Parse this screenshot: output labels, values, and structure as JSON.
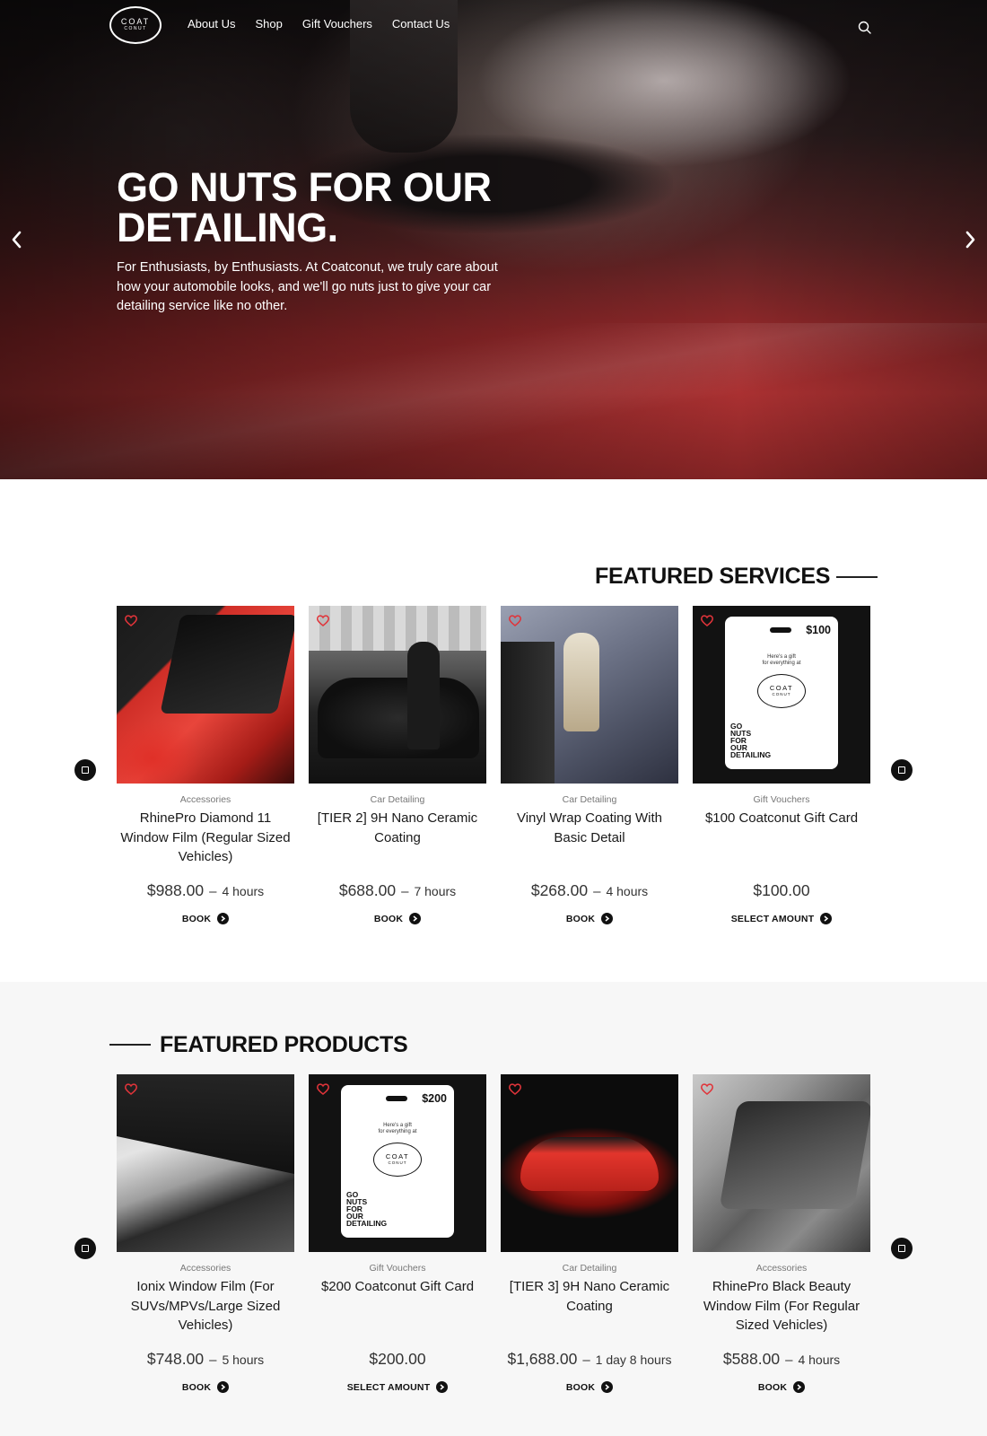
{
  "nav": {
    "logo_line1": "COAT",
    "logo_line2": "CONUT",
    "links": [
      "About Us",
      "Shop",
      "Gift Vouchers",
      "Contact Us"
    ]
  },
  "hero": {
    "title_line1": "GO NUTS FOR OUR",
    "title_line2": "DETAILING.",
    "subtitle": "For Enthusiasts, by Enthusiasts. At Coatconut, we truly care about how your automobile looks, and we'll go nuts just to give your car detailing service like no other."
  },
  "services": {
    "heading": "FEATURED SERVICES",
    "items": [
      {
        "category": "Accessories",
        "name": "RhinePro Diamond 11 Window Film (Regular Sized Vehicles)",
        "price": "$988.00",
        "duration": "4 hours",
        "cta": "BOOK"
      },
      {
        "category": "Car Detailing",
        "name": "[TIER 2] 9H Nano Ceramic Coating",
        "price": "$688.00",
        "duration": "7 hours",
        "cta": "BOOK"
      },
      {
        "category": "Car Detailing",
        "name": "Vinyl Wrap Coating With Basic Detail",
        "price": "$268.00",
        "duration": "4 hours",
        "cta": "BOOK"
      },
      {
        "category": "Gift Vouchers",
        "name": "$100 Coatconut Gift Card",
        "price": "$100.00",
        "duration": "",
        "cta": "SELECT AMOUNT"
      }
    ]
  },
  "products": {
    "heading": "FEATURED PRODUCTS",
    "items": [
      {
        "category": "Accessories",
        "name": "Ionix Window Film (For SUVs/MPVs/Large Sized Vehicles)",
        "price": "$748.00",
        "duration": "5 hours",
        "cta": "BOOK"
      },
      {
        "category": "Gift Vouchers",
        "name": "$200 Coatconut Gift Card",
        "price": "$200.00",
        "duration": "",
        "cta": "SELECT AMOUNT"
      },
      {
        "category": "Car Detailing",
        "name": "[TIER 3] 9H Nano Ceramic Coating",
        "price": "$1,688.00",
        "duration": "1 day 8 hours",
        "cta": "BOOK"
      },
      {
        "category": "Accessories",
        "name": "RhinePro Black Beauty Window Film (For Regular Sized Vehicles)",
        "price": "$588.00",
        "duration": "4 hours",
        "cta": "BOOK"
      }
    ]
  },
  "gift_cards": {
    "card100": {
      "amount": "$100",
      "note_line1": "Here's a gift",
      "note_line2": "for everything at",
      "mark1": "COAT",
      "mark2": "CONUT",
      "slogan": [
        "GO",
        "NUTS",
        "FOR",
        "OUR",
        "DETAILING"
      ]
    },
    "card200": {
      "amount": "$200",
      "note_line1": "Here's a gift",
      "note_line2": "for everything at",
      "mark1": "COAT",
      "mark2": "CONUT",
      "slogan": [
        "GO",
        "NUTS",
        "FOR",
        "OUR",
        "DETAILING"
      ]
    }
  },
  "colors": {
    "accent_red": "#e0343a",
    "dark": "#111111",
    "products_bg": "#f7f7f7"
  },
  "icons": {
    "search": "search-icon",
    "heart": "heart-icon",
    "arrow_left": "chevron-left-icon",
    "arrow_right": "chevron-right-icon",
    "cta": "arrow-circle-icon"
  }
}
